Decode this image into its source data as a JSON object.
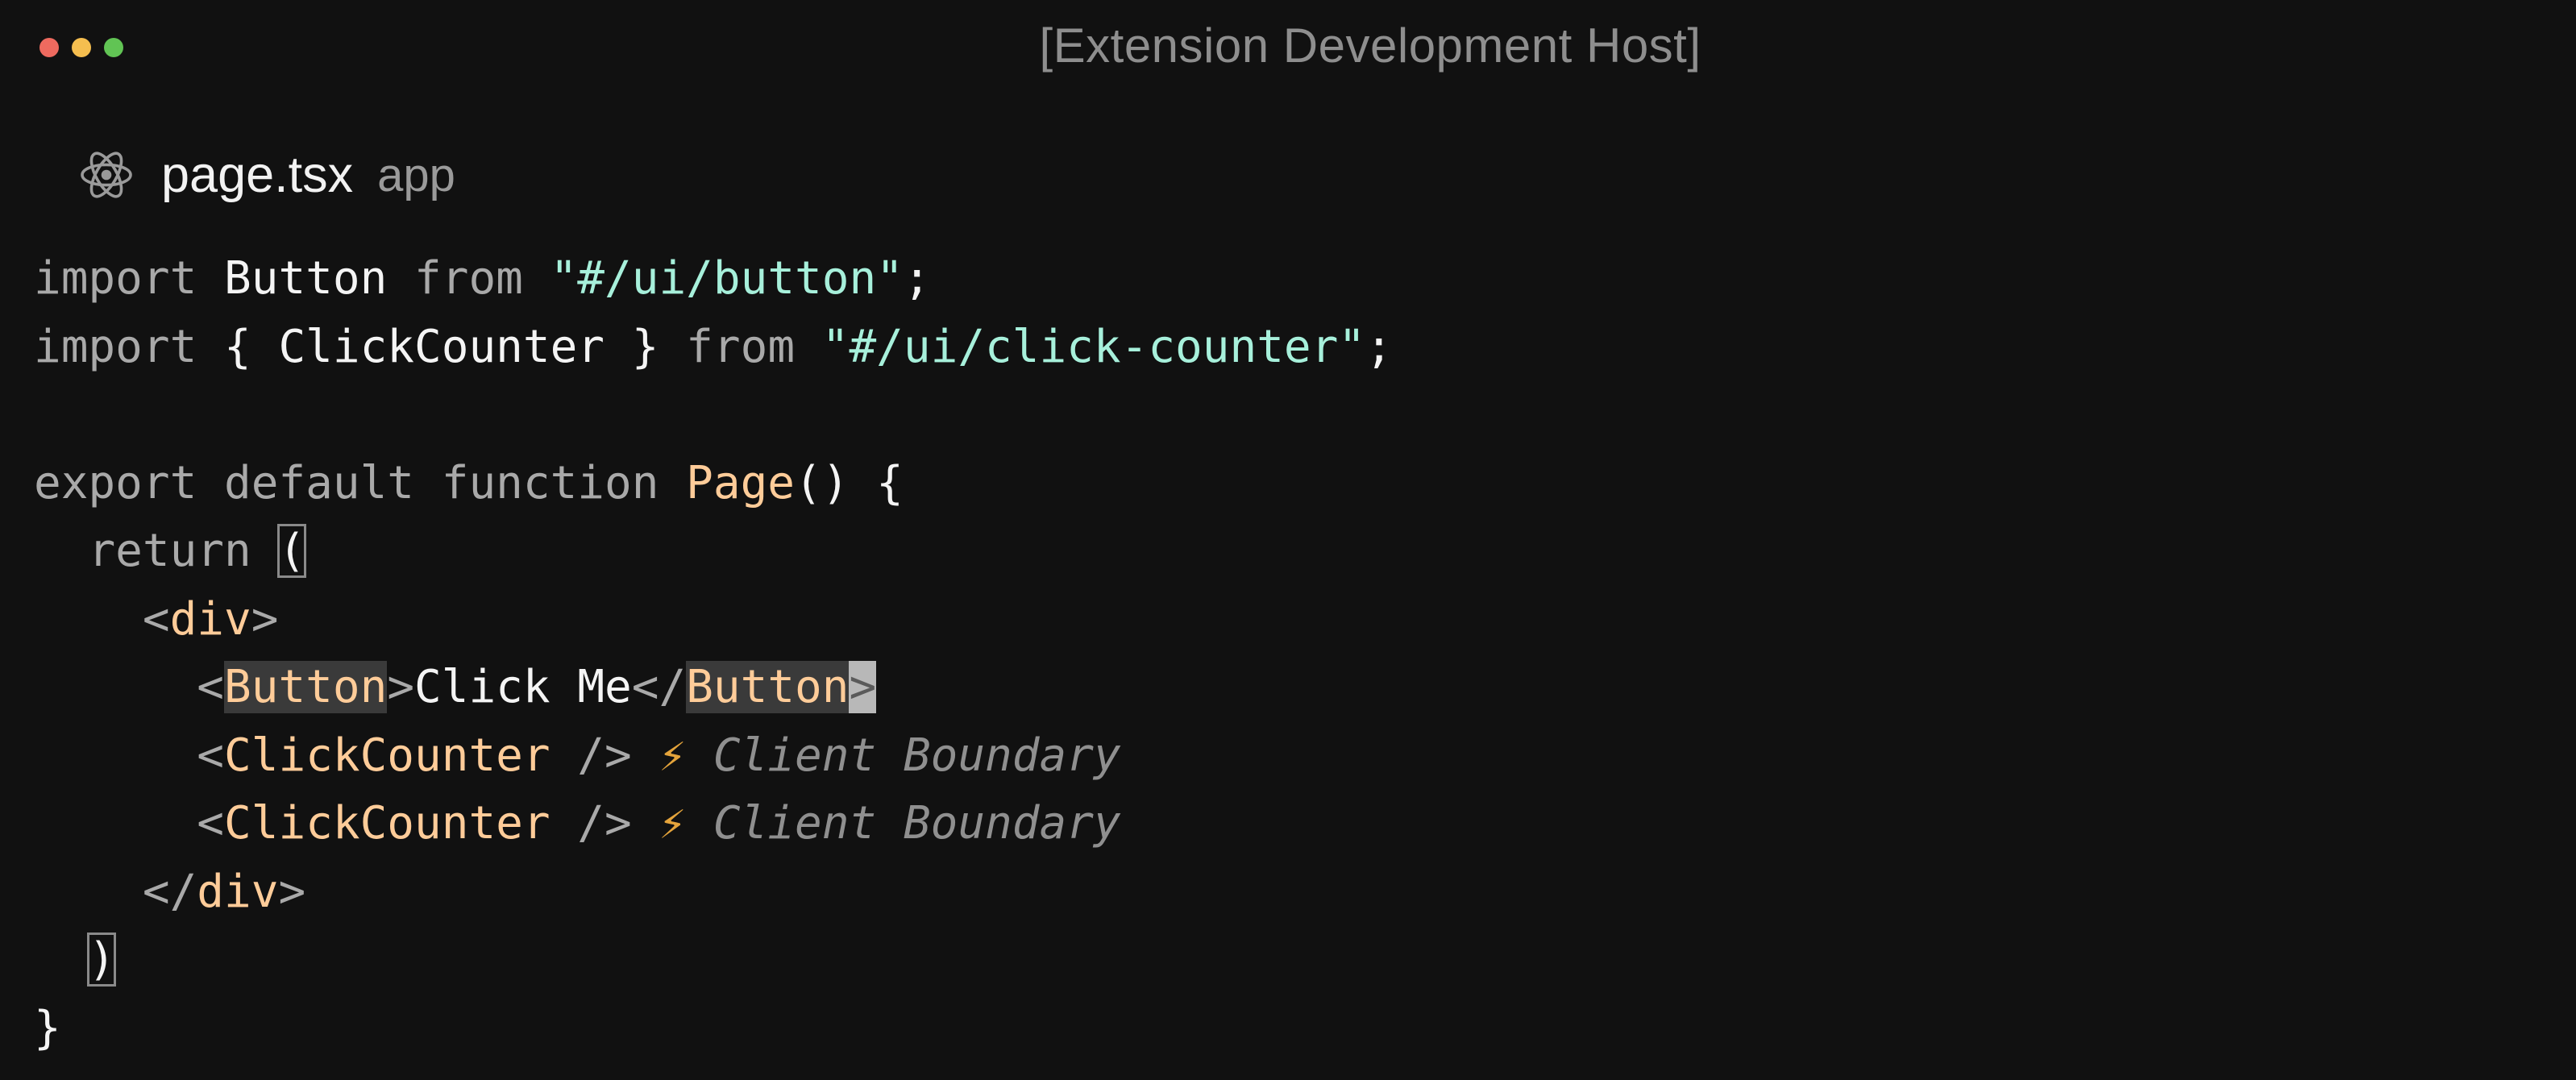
{
  "window": {
    "title": "[Extension Development Host]"
  },
  "tab": {
    "file_name": "page.tsx",
    "folder": "app",
    "icon": "react-icon"
  },
  "code": {
    "line1": {
      "kw1": "import",
      "ident": " Button ",
      "kw2": "from",
      "str": "\"#/ui/button\"",
      "end": ";"
    },
    "line2": {
      "kw1": "import",
      "ident": " { ClickCounter } ",
      "kw2": "from",
      "str": "\"#/ui/click-counter\"",
      "end": ";"
    },
    "line4": {
      "kw": "export default function ",
      "fn": "Page",
      "rest": "() {"
    },
    "line5": {
      "kw": "return ",
      "paren": "("
    },
    "line6": {
      "open": "<",
      "tag": "div",
      "close": ">"
    },
    "line7": {
      "open": "<",
      "tag": "Button",
      "close": ">",
      "text": "Click Me",
      "open2": "</",
      "tag2": "Button",
      "close2": ">"
    },
    "line8": {
      "open": "<",
      "tag": "ClickCounter",
      "close": " />",
      "bolt": "⚡",
      "comment": " Client Boundary"
    },
    "line9": {
      "open": "<",
      "tag": "ClickCounter",
      "close": " />",
      "bolt": "⚡",
      "comment": " Client Boundary"
    },
    "line10": {
      "open": "</",
      "tag": "div",
      "close": ">"
    },
    "line11": {
      "paren": ")"
    },
    "line12": {
      "brace": "}"
    }
  }
}
